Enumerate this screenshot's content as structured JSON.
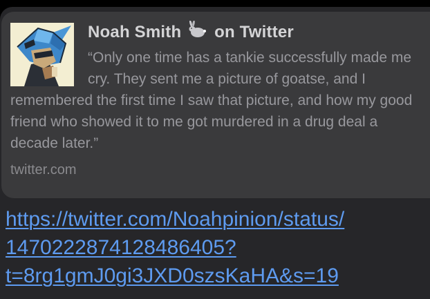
{
  "link_preview": {
    "title_name": "Noah Smith",
    "title_suffix": "on Twitter",
    "rabbit_icon": "🐇",
    "quote": "“Only one time has a tankie successfully made me cry. They sent me a picture of goatse, and I remembered the first time I saw that picture, and how my good friend who showed it to me got murdered in a drug deal a decade later.”",
    "source": "twitter.com",
    "avatar_icon": "cartoon-character-avatar"
  },
  "message": {
    "link_lines": [
      "https://twitter.com/Noahpinion/status/",
      "1470222874128486405?",
      "t=8rg1gmJ0gi3JXD0szsKaHA&s=19"
    ]
  },
  "colors": {
    "background": "#000000",
    "bubble": "#262629",
    "preview_card": "#3a3a3c",
    "title_text": "#d4d4d6",
    "body_text": "#98989d",
    "link": "#5e9bf0"
  }
}
